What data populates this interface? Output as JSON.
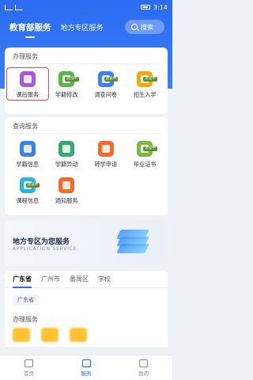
{
  "status": {
    "time": "3:14"
  },
  "header": {
    "tabs": [
      {
        "label": "教育部服务"
      },
      {
        "label": "地方专区服务"
      }
    ],
    "search": {
      "placeholder": "搜索"
    }
  },
  "office": {
    "title": "办理服务",
    "items": [
      {
        "label": "课后服务",
        "color": "#a45ad7",
        "icon": "bag-icon",
        "selected": true
      },
      {
        "label": "学籍修改",
        "color": "#5bb54a",
        "icon": "edit-icon",
        "badge": "建设中"
      },
      {
        "label": "调查问卷",
        "color": "#3c7ff0",
        "icon": "survey-icon",
        "badge": "建设中"
      },
      {
        "label": "招生入学",
        "color": "#f2a80d",
        "icon": "admission-icon",
        "badge": "建设中"
      }
    ]
  },
  "query": {
    "title": "查询服务",
    "items": [
      {
        "label": "学籍信息",
        "color": "#3c7ff0",
        "icon": "record-icon"
      },
      {
        "label": "学籍异动",
        "color": "#37a86f",
        "icon": "transfer-icon"
      },
      {
        "label": "转学申请",
        "color": "#f26b2a",
        "icon": "apply-icon"
      },
      {
        "label": "毕业证书",
        "color": "#7bb843",
        "icon": "certificate-icon",
        "badge": "建设中"
      },
      {
        "label": "课程信息",
        "color": "#2db4d7",
        "icon": "course-icon",
        "badge": "建设中"
      },
      {
        "label": "通知服务",
        "color": "#f26b2a",
        "icon": "notice-icon"
      }
    ]
  },
  "banner": {
    "title": "地方专区为您服务",
    "subtitle": "APPLICATION SERVICE"
  },
  "region": {
    "tabs": [
      {
        "label": "广东省"
      },
      {
        "label": "广州市"
      },
      {
        "label": "番禺区"
      },
      {
        "label": "学校"
      }
    ],
    "chip": "广东省",
    "title": "办理服务"
  },
  "tabbar": [
    {
      "label": "首页"
    },
    {
      "label": "服务"
    },
    {
      "label": "我的"
    }
  ]
}
